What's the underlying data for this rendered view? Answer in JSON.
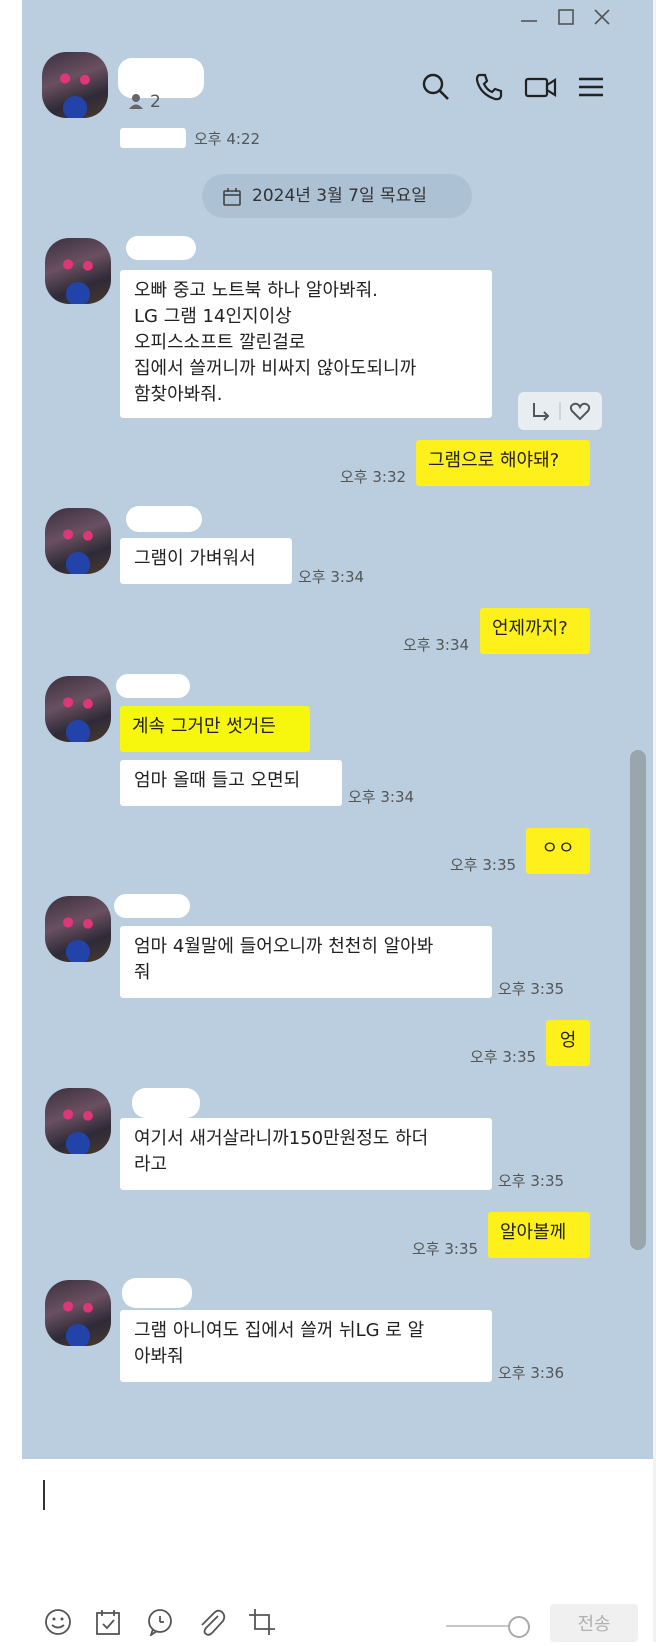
{
  "header": {
    "member_count": "2"
  },
  "top_partial_time": "오후 4:22",
  "date_divider": "2024년 3월 7일 목요일",
  "messages": [
    {
      "side": "left",
      "text": "오빠 중고 노트북 하나 알아봐줘.\nLG 그램 14인지이상\n오피스소프트 깔린걸로\n집에서 쓸꺼니까 비싸지 않아도되니까\n함찾아봐줘.",
      "time": ""
    },
    {
      "side": "right",
      "text": "그램으로 해야돼?",
      "time": "오후 3:32"
    },
    {
      "side": "left",
      "text": "그램이 가벼워서",
      "time": "오후 3:34"
    },
    {
      "side": "right",
      "text": "언제까지?",
      "time": "오후 3:34"
    },
    {
      "side": "left",
      "text": "계속 그거만 썻거든",
      "time": ""
    },
    {
      "side": "left",
      "text": "엄마 올때 들고 오면되",
      "time": "오후 3:34"
    },
    {
      "side": "right",
      "text": "ㅇㅇ",
      "time": "오후 3:35"
    },
    {
      "side": "left",
      "text": "엄마 4월말에 들어오니까 천천히 알아봐\n줘",
      "time": "오후 3:35"
    },
    {
      "side": "right",
      "text": "엉",
      "time": "오후 3:35"
    },
    {
      "side": "left",
      "text": "여기서 새거살라니까150만원정도 하더\n라고",
      "time": "오후 3:35"
    },
    {
      "side": "right",
      "text": "알아볼께",
      "time": "오후 3:35"
    },
    {
      "side": "left",
      "text": "그램 아니여도 집에서 쓸꺼 뉘LG 로 알\n아봐줘",
      "time": "오후 3:36"
    }
  ],
  "input": {
    "send_label": "전송"
  },
  "colors": {
    "chat_bg": "#bacee0",
    "my_bubble": "#fef01b",
    "their_bubble": "#ffffff",
    "highlight": "#f5f50a"
  },
  "icons": [
    "minimize-icon",
    "maximize-icon",
    "close-icon",
    "person-icon",
    "search-icon",
    "phone-icon",
    "video-icon",
    "menu-icon",
    "calendar-icon",
    "share-icon",
    "heart-icon",
    "emoji-icon",
    "schedule-icon",
    "chat-icon",
    "attach-icon",
    "capture-icon"
  ]
}
